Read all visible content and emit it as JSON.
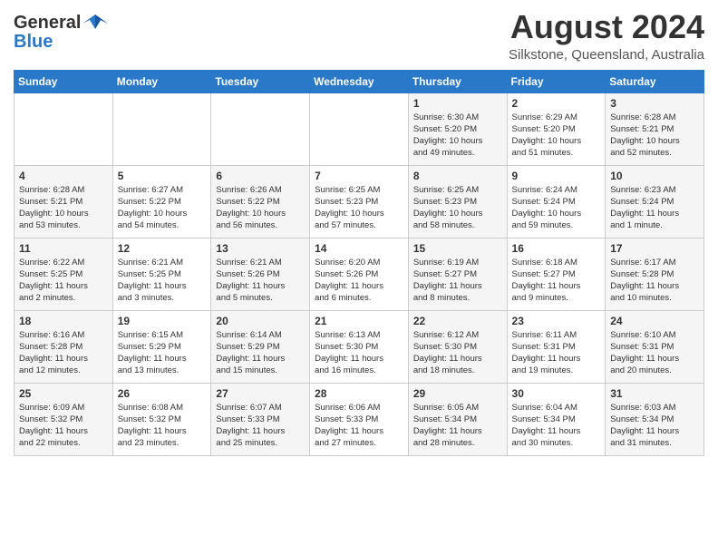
{
  "header": {
    "logo_general": "General",
    "logo_blue": "Blue",
    "month_title": "August 2024",
    "location": "Silkstone, Queensland, Australia"
  },
  "weekdays": [
    "Sunday",
    "Monday",
    "Tuesday",
    "Wednesday",
    "Thursday",
    "Friday",
    "Saturday"
  ],
  "weeks": [
    [
      {
        "day": "",
        "info": ""
      },
      {
        "day": "",
        "info": ""
      },
      {
        "day": "",
        "info": ""
      },
      {
        "day": "",
        "info": ""
      },
      {
        "day": "1",
        "info": "Sunrise: 6:30 AM\nSunset: 5:20 PM\nDaylight: 10 hours\nand 49 minutes."
      },
      {
        "day": "2",
        "info": "Sunrise: 6:29 AM\nSunset: 5:20 PM\nDaylight: 10 hours\nand 51 minutes."
      },
      {
        "day": "3",
        "info": "Sunrise: 6:28 AM\nSunset: 5:21 PM\nDaylight: 10 hours\nand 52 minutes."
      }
    ],
    [
      {
        "day": "4",
        "info": "Sunrise: 6:28 AM\nSunset: 5:21 PM\nDaylight: 10 hours\nand 53 minutes."
      },
      {
        "day": "5",
        "info": "Sunrise: 6:27 AM\nSunset: 5:22 PM\nDaylight: 10 hours\nand 54 minutes."
      },
      {
        "day": "6",
        "info": "Sunrise: 6:26 AM\nSunset: 5:22 PM\nDaylight: 10 hours\nand 56 minutes."
      },
      {
        "day": "7",
        "info": "Sunrise: 6:25 AM\nSunset: 5:23 PM\nDaylight: 10 hours\nand 57 minutes."
      },
      {
        "day": "8",
        "info": "Sunrise: 6:25 AM\nSunset: 5:23 PM\nDaylight: 10 hours\nand 58 minutes."
      },
      {
        "day": "9",
        "info": "Sunrise: 6:24 AM\nSunset: 5:24 PM\nDaylight: 10 hours\nand 59 minutes."
      },
      {
        "day": "10",
        "info": "Sunrise: 6:23 AM\nSunset: 5:24 PM\nDaylight: 11 hours\nand 1 minute."
      }
    ],
    [
      {
        "day": "11",
        "info": "Sunrise: 6:22 AM\nSunset: 5:25 PM\nDaylight: 11 hours\nand 2 minutes."
      },
      {
        "day": "12",
        "info": "Sunrise: 6:21 AM\nSunset: 5:25 PM\nDaylight: 11 hours\nand 3 minutes."
      },
      {
        "day": "13",
        "info": "Sunrise: 6:21 AM\nSunset: 5:26 PM\nDaylight: 11 hours\nand 5 minutes."
      },
      {
        "day": "14",
        "info": "Sunrise: 6:20 AM\nSunset: 5:26 PM\nDaylight: 11 hours\nand 6 minutes."
      },
      {
        "day": "15",
        "info": "Sunrise: 6:19 AM\nSunset: 5:27 PM\nDaylight: 11 hours\nand 8 minutes."
      },
      {
        "day": "16",
        "info": "Sunrise: 6:18 AM\nSunset: 5:27 PM\nDaylight: 11 hours\nand 9 minutes."
      },
      {
        "day": "17",
        "info": "Sunrise: 6:17 AM\nSunset: 5:28 PM\nDaylight: 11 hours\nand 10 minutes."
      }
    ],
    [
      {
        "day": "18",
        "info": "Sunrise: 6:16 AM\nSunset: 5:28 PM\nDaylight: 11 hours\nand 12 minutes."
      },
      {
        "day": "19",
        "info": "Sunrise: 6:15 AM\nSunset: 5:29 PM\nDaylight: 11 hours\nand 13 minutes."
      },
      {
        "day": "20",
        "info": "Sunrise: 6:14 AM\nSunset: 5:29 PM\nDaylight: 11 hours\nand 15 minutes."
      },
      {
        "day": "21",
        "info": "Sunrise: 6:13 AM\nSunset: 5:30 PM\nDaylight: 11 hours\nand 16 minutes."
      },
      {
        "day": "22",
        "info": "Sunrise: 6:12 AM\nSunset: 5:30 PM\nDaylight: 11 hours\nand 18 minutes."
      },
      {
        "day": "23",
        "info": "Sunrise: 6:11 AM\nSunset: 5:31 PM\nDaylight: 11 hours\nand 19 minutes."
      },
      {
        "day": "24",
        "info": "Sunrise: 6:10 AM\nSunset: 5:31 PM\nDaylight: 11 hours\nand 20 minutes."
      }
    ],
    [
      {
        "day": "25",
        "info": "Sunrise: 6:09 AM\nSunset: 5:32 PM\nDaylight: 11 hours\nand 22 minutes."
      },
      {
        "day": "26",
        "info": "Sunrise: 6:08 AM\nSunset: 5:32 PM\nDaylight: 11 hours\nand 23 minutes."
      },
      {
        "day": "27",
        "info": "Sunrise: 6:07 AM\nSunset: 5:33 PM\nDaylight: 11 hours\nand 25 minutes."
      },
      {
        "day": "28",
        "info": "Sunrise: 6:06 AM\nSunset: 5:33 PM\nDaylight: 11 hours\nand 27 minutes."
      },
      {
        "day": "29",
        "info": "Sunrise: 6:05 AM\nSunset: 5:34 PM\nDaylight: 11 hours\nand 28 minutes."
      },
      {
        "day": "30",
        "info": "Sunrise: 6:04 AM\nSunset: 5:34 PM\nDaylight: 11 hours\nand 30 minutes."
      },
      {
        "day": "31",
        "info": "Sunrise: 6:03 AM\nSunset: 5:34 PM\nDaylight: 11 hours\nand 31 minutes."
      }
    ]
  ]
}
